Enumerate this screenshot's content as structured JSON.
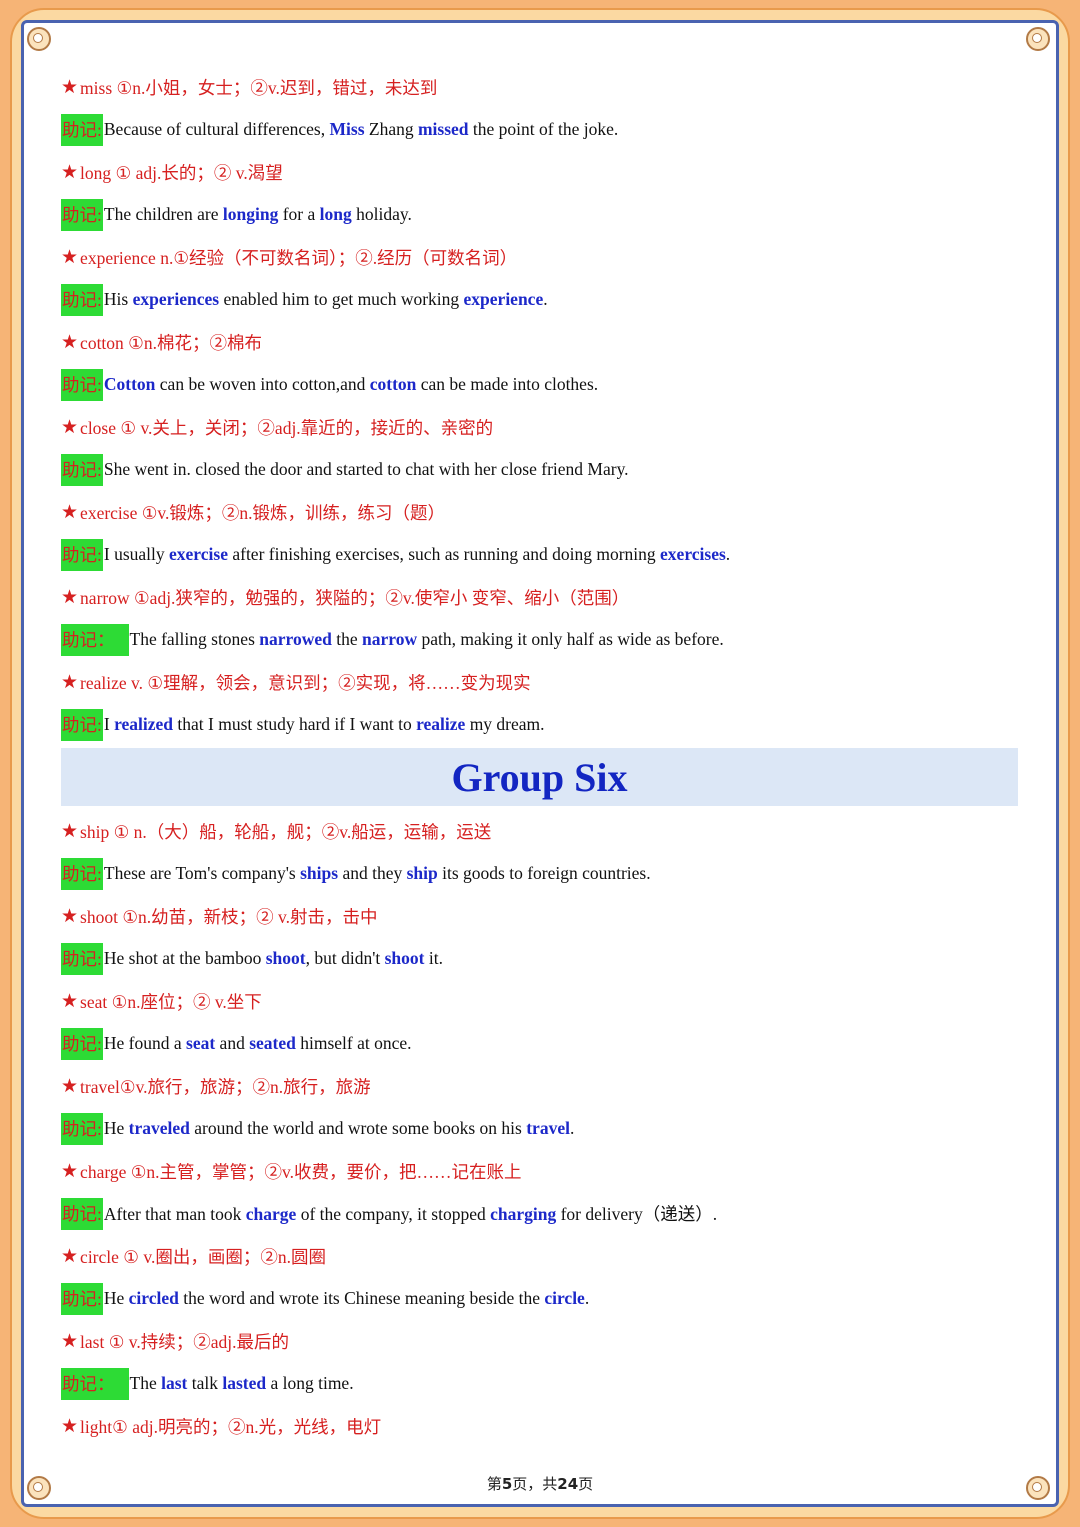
{
  "group_title": "Group Six",
  "mem_tag": "助记:",
  "mem_tag_alt": "助记：",
  "rows": [
    {
      "kind": "def",
      "text": "miss ①n.小姐，女士；②v.迟到，错过，未达到"
    },
    {
      "kind": "mem",
      "tag": "助记:",
      "parts": [
        [
          "Because of cultural differences, ",
          0
        ],
        [
          "Miss",
          1
        ],
        [
          " Zhang ",
          0
        ],
        [
          "missed",
          1
        ],
        [
          " the point of the joke.",
          0
        ]
      ]
    },
    {
      "kind": "def",
      "text": "long ① adj.长的；② v.渴望"
    },
    {
      "kind": "mem",
      "tag": "助记:",
      "parts": [
        [
          "The children are ",
          0
        ],
        [
          "longing",
          1
        ],
        [
          " for a ",
          0
        ],
        [
          "long",
          1
        ],
        [
          " holiday.",
          0
        ]
      ]
    },
    {
      "kind": "def",
      "text": "experience n.①经验（不可数名词）；②.经历（可数名词）"
    },
    {
      "kind": "mem",
      "tag": "助记:",
      "parts": [
        [
          "His ",
          0
        ],
        [
          "experiences",
          1
        ],
        [
          " enabled him to get much working ",
          0
        ],
        [
          "experience",
          1
        ],
        [
          ".",
          0
        ]
      ]
    },
    {
      "kind": "def",
      "text": "cotton ①n.棉花；②棉布"
    },
    {
      "kind": "mem",
      "tag": "助记:",
      "parts": [
        [
          "Cotton",
          1
        ],
        [
          " can be woven into cotton,and ",
          0
        ],
        [
          "cotton",
          1
        ],
        [
          " can be made into clothes.",
          0
        ]
      ]
    },
    {
      "kind": "def",
      "text": "close ① v.关上，关闭；②adj.靠近的，接近的、亲密的"
    },
    {
      "kind": "mem",
      "tag": "助记:",
      "parts": [
        [
          "She went in. closed the door and started to chat with her close friend Mary.",
          0
        ]
      ]
    },
    {
      "kind": "def",
      "text": "exercise ①v.锻炼；②n.锻炼，训练，练习（题）"
    },
    {
      "kind": "mem",
      "tag": "助记:",
      "parts": [
        [
          "I usually ",
          0
        ],
        [
          "exercise",
          1
        ],
        [
          " after finishing exercises, such as running and doing morning ",
          0
        ],
        [
          "exercises",
          1
        ],
        [
          ".",
          0
        ]
      ]
    },
    {
      "kind": "def",
      "text": "narrow ①adj.狭窄的，勉强的，狭隘的；②v.使窄小 变窄、缩小（范围）"
    },
    {
      "kind": "mem",
      "tag": "助记：",
      "wide": true,
      "parts": [
        [
          "The falling stones ",
          0
        ],
        [
          "narrowed",
          1
        ],
        [
          " the ",
          0
        ],
        [
          "narrow",
          1
        ],
        [
          " path, making it only half as wide as before.",
          0
        ]
      ]
    },
    {
      "kind": "def",
      "text": " realize v. ①理解，领会，意识到；②实现，将……变为现实"
    },
    {
      "kind": "mem",
      "tag": "助记:",
      "parts": [
        [
          "I ",
          0
        ],
        [
          "realized",
          1
        ],
        [
          " that I must study hard if I want to ",
          0
        ],
        [
          "realize",
          1
        ],
        [
          " my dream.",
          0
        ]
      ]
    },
    {
      "kind": "banner"
    },
    {
      "kind": "def",
      "text": "ship ① n.（大）船，轮船，舰；②v.船运，运输，运送"
    },
    {
      "kind": "mem",
      "tag": "助记:",
      "parts": [
        [
          "These are Tom's company's ",
          0
        ],
        [
          "ships",
          1
        ],
        [
          " and they ",
          0
        ],
        [
          "ship",
          1
        ],
        [
          " its goods to foreign countries.",
          0
        ]
      ]
    },
    {
      "kind": "def",
      "text": "shoot ①n.幼苗，新枝；② v.射击，击中"
    },
    {
      "kind": "mem",
      "tag": "助记:",
      "parts": [
        [
          "He shot at the bamboo ",
          0
        ],
        [
          "shoot",
          1
        ],
        [
          ", but didn't ",
          0
        ],
        [
          "shoot",
          1
        ],
        [
          " it.",
          0
        ]
      ]
    },
    {
      "kind": "def",
      "text": "seat ①n.座位；② v.坐下"
    },
    {
      "kind": "mem",
      "tag": "助记:",
      "parts": [
        [
          "He found a ",
          0
        ],
        [
          "seat",
          1
        ],
        [
          " and ",
          0
        ],
        [
          "seated",
          1
        ],
        [
          " himself at once.",
          0
        ]
      ]
    },
    {
      "kind": "def",
      "text": "travel①v.旅行，旅游；②n.旅行，旅游"
    },
    {
      "kind": "mem",
      "tag": "助记:",
      "parts": [
        [
          "He ",
          0
        ],
        [
          "traveled",
          1
        ],
        [
          " around the world and wrote some books on his ",
          0
        ],
        [
          "travel",
          1
        ],
        [
          ".",
          0
        ]
      ]
    },
    {
      "kind": "def",
      "text": "charge ①n.主管，掌管；②v.收费，要价，把……记在账上"
    },
    {
      "kind": "mem",
      "tag": "助记:",
      "parts": [
        [
          "After that man took ",
          0
        ],
        [
          "charge",
          1
        ],
        [
          " of the company, it stopped ",
          0
        ],
        [
          "charging",
          1
        ],
        [
          " for delivery（递送）.",
          0
        ]
      ]
    },
    {
      "kind": "def",
      "text": "circle ① v.圈出，画圈；②n.圆圈"
    },
    {
      "kind": "mem",
      "tag": "助记:",
      "parts": [
        [
          "He ",
          0
        ],
        [
          "circled",
          1
        ],
        [
          " the word and wrote its Chinese meaning beside the ",
          0
        ],
        [
          "circle",
          1
        ],
        [
          ".",
          0
        ]
      ]
    },
    {
      "kind": "def",
      "text": "last ① v.持续；②adj.最后的"
    },
    {
      "kind": "mem",
      "tag": "助记：",
      "wide": true,
      "parts": [
        [
          "The ",
          0
        ],
        [
          "last",
          1
        ],
        [
          " talk ",
          0
        ],
        [
          "lasted",
          1
        ],
        [
          " a long time.",
          0
        ]
      ]
    },
    {
      "kind": "def",
      "text": "light① adj.明亮的；②n.光，光线，电灯"
    }
  ],
  "footer": {
    "prefix": "第",
    "page": "5",
    "middle": "页，共",
    "total": "24",
    "suffix": "页"
  },
  "colors": {
    "definition": "#d62020",
    "highlight": "#1c28c9",
    "tag_bg": "#2ddb35",
    "banner_bg": "#dce7f6",
    "border": "#4a63b0",
    "outer": "#f6b476"
  },
  "icons": {
    "star": "★"
  }
}
